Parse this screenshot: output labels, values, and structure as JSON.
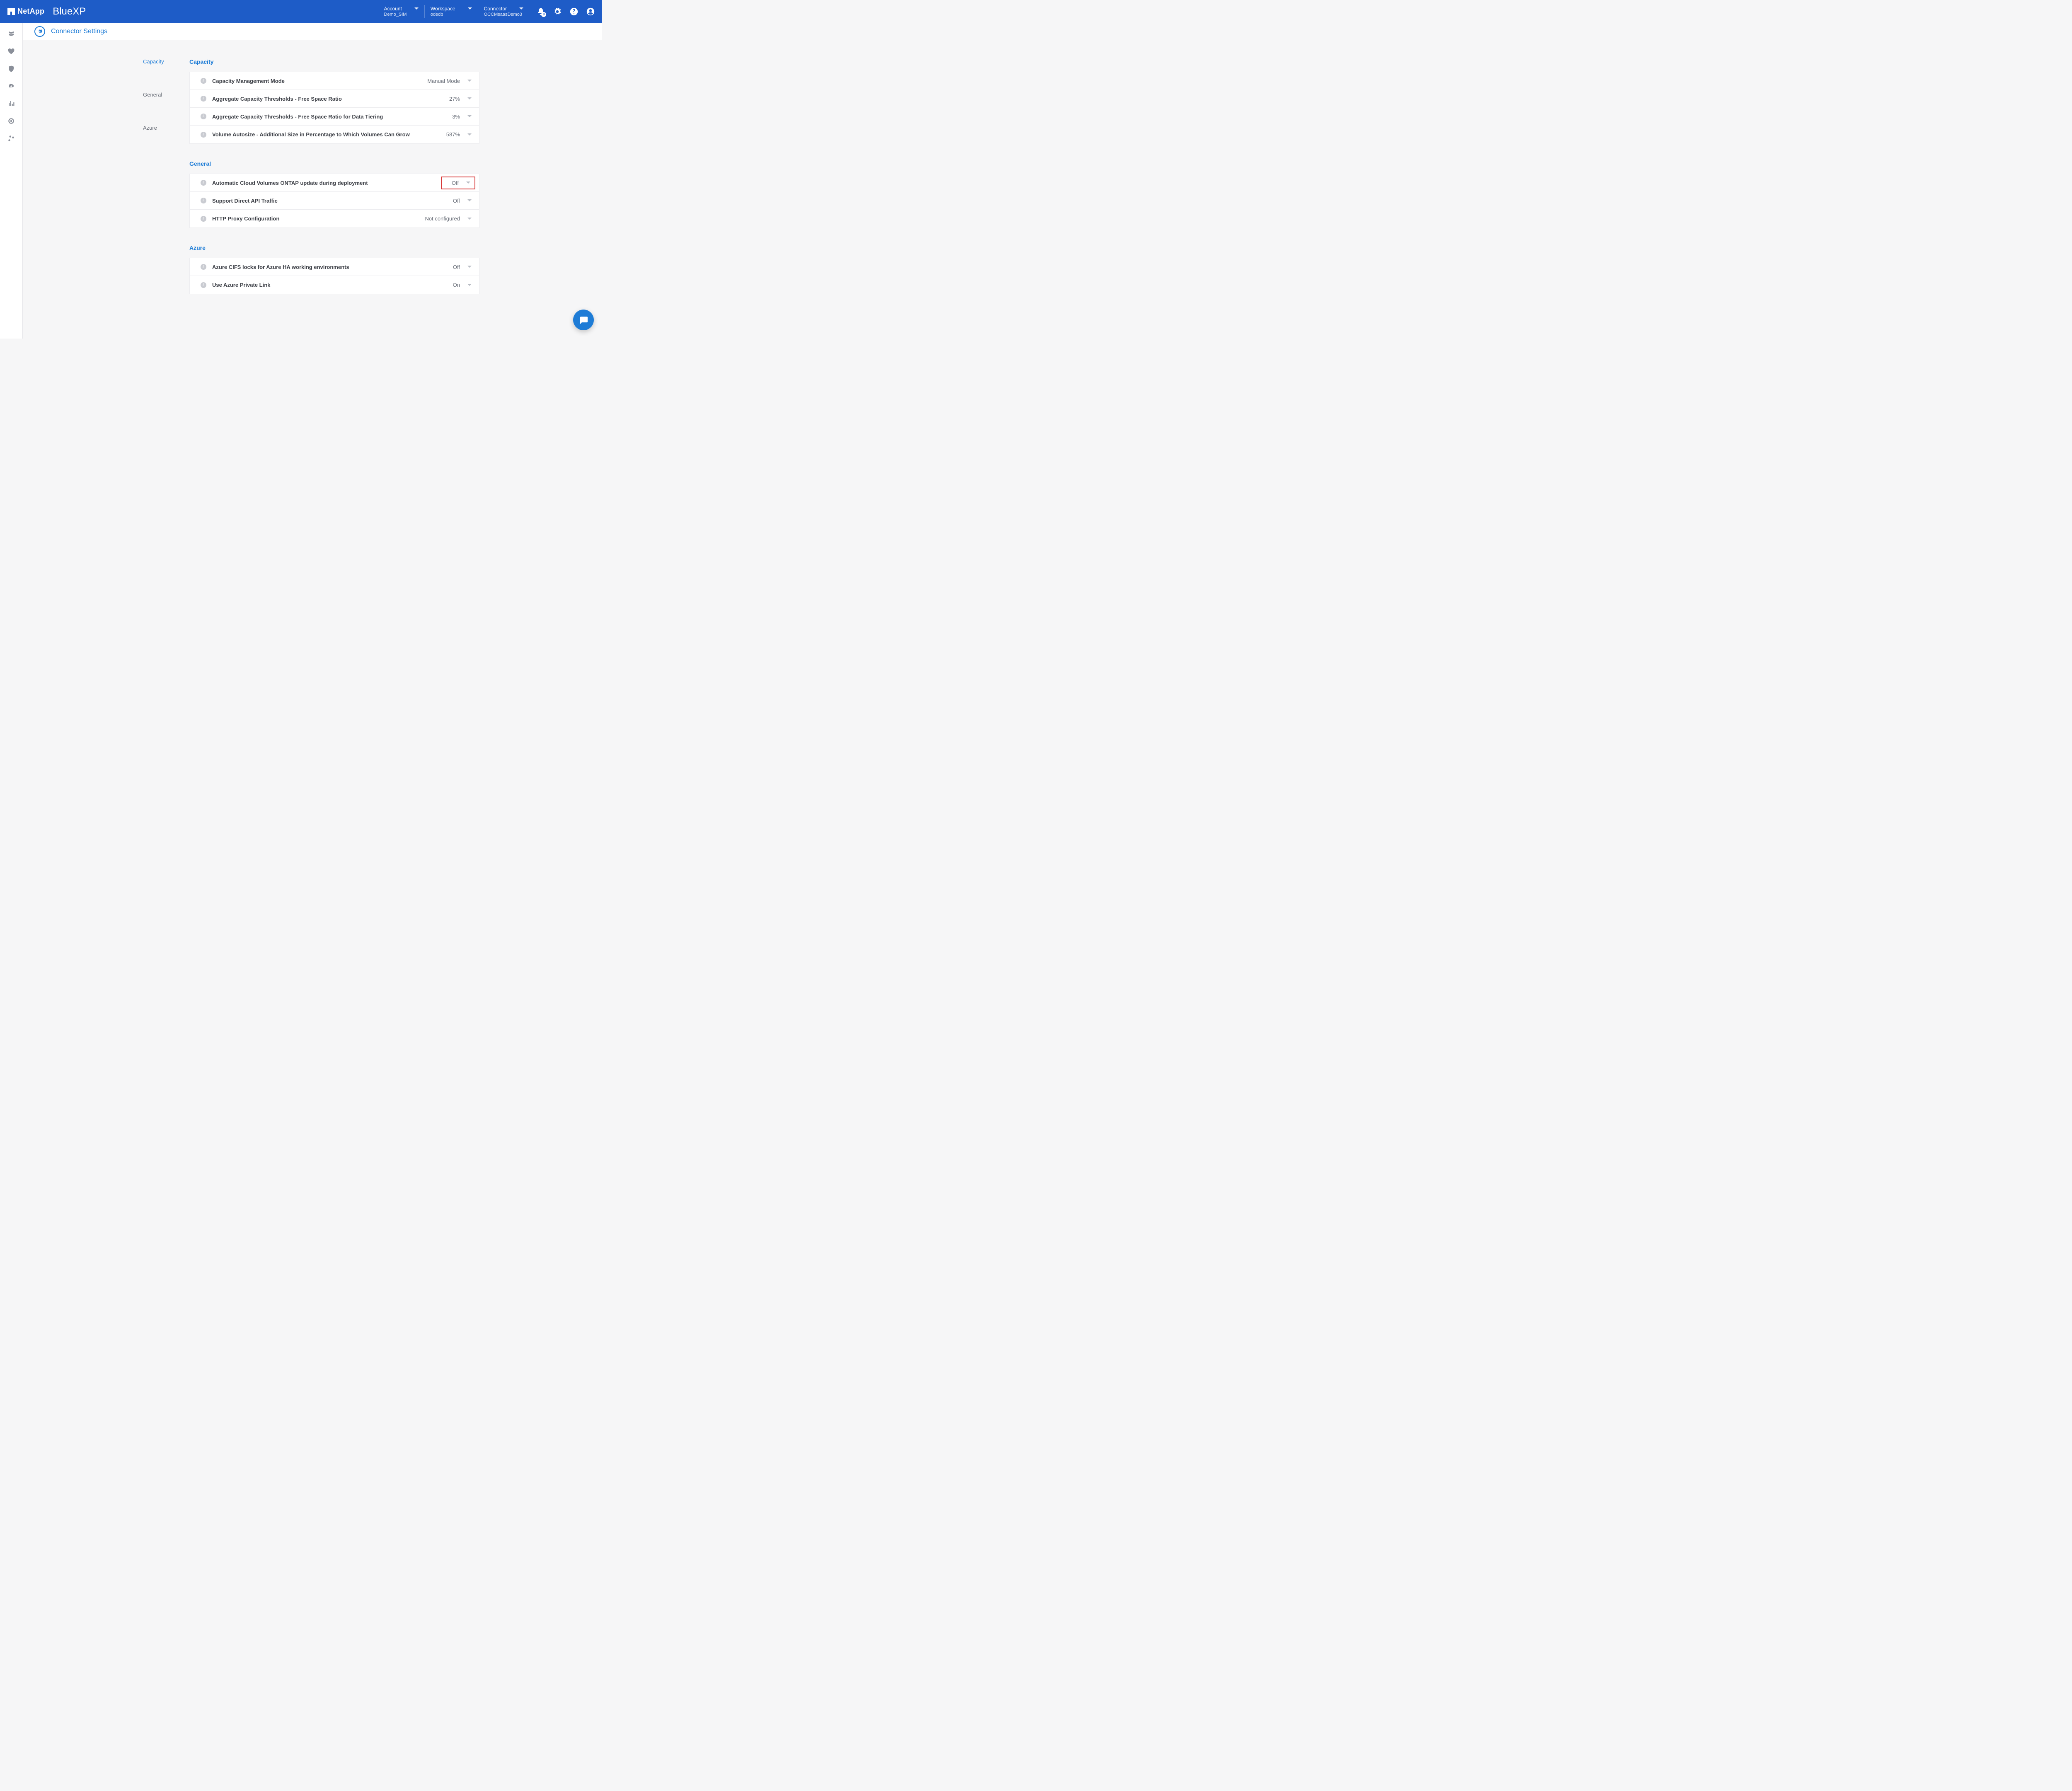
{
  "header": {
    "brand_primary": "NetApp",
    "brand_product": "BlueXP",
    "account_label": "Account",
    "account_value": "Demo_SIM",
    "workspace_label": "Workspace",
    "workspace_value": "odedb",
    "connector_label": "Connector",
    "connector_value": "OCCMsaasDemo3",
    "notification_count": "8"
  },
  "page": {
    "title": "Connector Settings"
  },
  "sidenav": {
    "item0": "Capacity",
    "item1": "General",
    "item2": "Azure"
  },
  "sections": {
    "capacity": {
      "title": "Capacity",
      "rows": {
        "r0": {
          "label": "Capacity Management Mode",
          "value": "Manual Mode"
        },
        "r1": {
          "label": "Aggregate Capacity Thresholds - Free Space Ratio",
          "value": "27%"
        },
        "r2": {
          "label": "Aggregate Capacity Thresholds - Free Space Ratio for Data Tiering",
          "value": "3%"
        },
        "r3": {
          "label": "Volume Autosize - Additional Size in Percentage to Which Volumes Can Grow",
          "value": "587%"
        }
      }
    },
    "general": {
      "title": "General",
      "rows": {
        "r0": {
          "label": "Automatic Cloud Volumes ONTAP update during deployment",
          "value": "Off"
        },
        "r1": {
          "label": "Support Direct API Traffic",
          "value": "Off"
        },
        "r2": {
          "label": "HTTP Proxy Configuration",
          "value": "Not configured"
        }
      }
    },
    "azure": {
      "title": "Azure",
      "rows": {
        "r0": {
          "label": "Azure CIFS locks for Azure HA working environments",
          "value": "Off"
        },
        "r1": {
          "label": "Use Azure Private Link",
          "value": "On"
        }
      }
    }
  }
}
